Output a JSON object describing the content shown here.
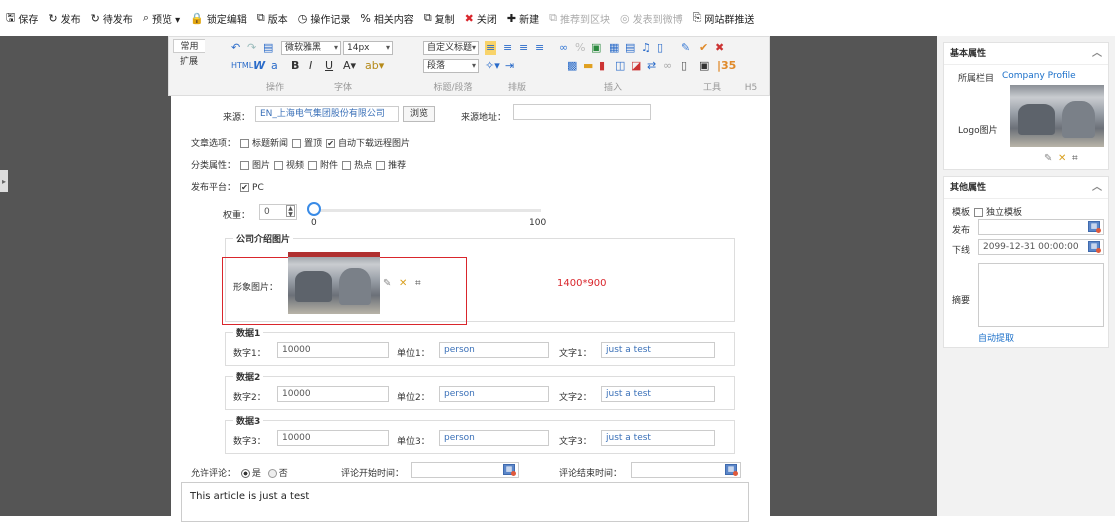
{
  "toolbar": {
    "items": [
      {
        "icon": "floppy-icon",
        "glyph": "🖫",
        "label": "保存"
      },
      {
        "icon": "refresh-icon",
        "glyph": "↻",
        "label": "发布"
      },
      {
        "icon": "refresh-icon",
        "glyph": "↻",
        "label": "待发布"
      },
      {
        "icon": "search-icon",
        "glyph": "⌕",
        "label": "预览 ▾"
      },
      {
        "icon": "lock-icon",
        "glyph": "🔒",
        "label": "锁定编辑"
      },
      {
        "icon": "copy-icon",
        "glyph": "⧉",
        "label": "版本"
      },
      {
        "icon": "clock-icon",
        "glyph": "◷",
        "label": "操作记录"
      },
      {
        "icon": "link-icon",
        "glyph": "%",
        "label": "相关内容"
      },
      {
        "icon": "copy-icon",
        "glyph": "⧉",
        "label": "复制"
      },
      {
        "icon": "close-icon",
        "glyph": "✖",
        "label": "关闭"
      },
      {
        "icon": "plus-icon",
        "glyph": "✚",
        "label": "新建"
      },
      {
        "icon": "block-icon",
        "glyph": "⧉",
        "label": "推荐到区块"
      },
      {
        "icon": "weibo-icon",
        "glyph": "◎",
        "label": "发表到微博"
      },
      {
        "icon": "share-icon",
        "glyph": "⎘",
        "label": "网站群推送"
      }
    ]
  },
  "ribbon": {
    "tab_common": "常用",
    "tab_extend": "扩展",
    "font_name": "微软雅黑",
    "font_size": "14px",
    "heading_select": "自定义标题",
    "paragraph_select": "段落",
    "groups": [
      "操作",
      "字体",
      "标题/段落",
      "排版",
      "插入",
      "工具",
      "H5"
    ]
  },
  "form": {
    "source_label": "来源：",
    "source_value": "EN_上海电气集团股份有限公司",
    "browse_button": "浏览",
    "source_url_label": "来源地址：",
    "source_url_value": "",
    "article_options_label": "文章选项：",
    "article_options": [
      {
        "label": "标题新闻",
        "checked": false
      },
      {
        "label": "置顶",
        "checked": false
      },
      {
        "label": "自动下载远程图片",
        "checked": true
      }
    ],
    "category_label": "分类属性：",
    "category_options": [
      {
        "label": "图片",
        "checked": false
      },
      {
        "label": "视频",
        "checked": false
      },
      {
        "label": "附件",
        "checked": false
      },
      {
        "label": "热点",
        "checked": false
      },
      {
        "label": "推荐",
        "checked": false
      }
    ],
    "platform_label": "发布平台：",
    "platform_value": "PC",
    "weight_label": "权重：",
    "weight_value": "0",
    "slider_min": "0",
    "slider_max": "100",
    "slider_level": 0,
    "company_section_title": "公司介绍图片",
    "image_label": "形象图片：",
    "image_size": "1400*900",
    "data_groups": [
      {
        "title": "数据1",
        "num_label": "数字1：",
        "num": "10000",
        "unit_label": "单位1：",
        "unit": "person",
        "text_label": "文字1：",
        "text": "just a test"
      },
      {
        "title": "数据2",
        "num_label": "数字2：",
        "num": "10000",
        "unit_label": "单位2：",
        "unit": "person",
        "text_label": "文字2：",
        "text": "just a test"
      },
      {
        "title": "数据3",
        "num_label": "数字3：",
        "num": "10000",
        "unit_label": "单位3：",
        "unit": "person",
        "text_label": "文字3：",
        "text": "just a test"
      }
    ],
    "comment_label": "允许评论：",
    "comment_yes": "是",
    "comment_no": "否",
    "comment_start_label": "评论开始时间：",
    "comment_end_label": "评论结束时间：",
    "body_text": "This article is just a test"
  },
  "right_panel": {
    "basic_title": "基本属性",
    "column_label": "所属栏目",
    "column_value": "Company Profile",
    "logo_label": "Logo图片",
    "other_title": "其他属性",
    "template_label": "模板",
    "independent_template": "独立模板",
    "publish_label": "发布",
    "publish_value": "",
    "offline_label": "下线",
    "offline_value": "2099-12-31 00:00:00",
    "summary_label": "摘要",
    "auto_extract": "自动提取"
  },
  "colors": {
    "accent_blue": "#1a6fc9",
    "highlight_red": "#d9262c",
    "editor_bg": "#555555"
  }
}
